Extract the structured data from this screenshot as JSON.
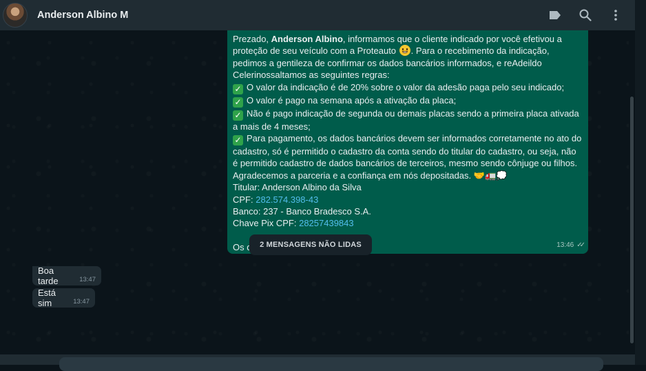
{
  "header": {
    "contact_name": "Anderson Albino M",
    "icons": [
      "label-icon",
      "search-icon",
      "menu-icon"
    ]
  },
  "outgoing": {
    "l1_a": "Prezado, ",
    "l1_name": "Anderson Albino",
    "l1_b": ", informamos que o cliente indicado por você efetivou a proteção de seu veículo com a Proteauto ",
    "l1_c": ". Para o recebimento da indicação, pedimos a gentileza de confirmar os dados bancários informados, e reAdeildo Celerinossaltamos as seguintes regras:",
    "rule1": "O valor da indicação é de 20% sobre o valor da adesão paga pelo seu indicado;",
    "rule2": "O valor é pago na semana após a ativação da placa;",
    "rule3": "Não é pago indicação de segunda ou demais placas sendo a primeira placa ativada a mais de 4 meses;",
    "rule4": "Para pagamento, os dados bancários devem ser informados corretamente no ato do cadastro, só é permitido o cadastro da conta sendo do titular do cadastro, ou seja, não é permitido cadastro de dados bancários de terceiros, mesmo sendo cônjuge ou filhos.",
    "thanks": "Agradecemos a parceria e a confiança em nós depositadas. ",
    "thanks_emoji": "🤝🚛💭",
    "titular": "Titular: Anderson Albino da Silva",
    "cpf_label": "CPF: ",
    "cpf": "282.574.398-43",
    "banco": "Banco: 237 - Banco Bradesco S.A.",
    "pix_label": "Chave Pix CPF: ",
    "pix": "28257439843",
    "question": "Os dados bancários conferem ?",
    "time": "13:46",
    "ticks": "✓✓"
  },
  "unread_label": "2 MENSAGENS NÃO LIDAS",
  "incoming": [
    {
      "text": "Boa tarde",
      "time": "13:47"
    },
    {
      "text": "Está sim",
      "time": "13:47"
    }
  ]
}
